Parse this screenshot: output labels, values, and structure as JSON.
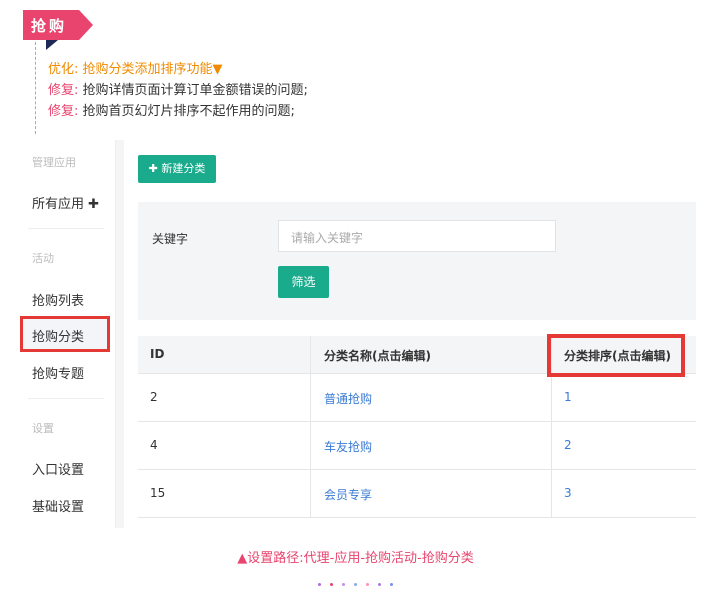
{
  "title_tag": "抢购",
  "notes": [
    {
      "kind": "优化:",
      "text": "抢购分类添加排序功能▼",
      "style": "opt"
    },
    {
      "kind": "修复:",
      "text": "抢购详情页面计算订单金额错误的问题;",
      "style": "fix"
    },
    {
      "kind": "修复:",
      "text": "抢购首页幻灯片排序不起作用的问题;",
      "style": "fix"
    }
  ],
  "sidebar": {
    "group_manage": "管理应用",
    "all_apps": "所有应用 ✚",
    "group_activity": "活动",
    "items": [
      "抢购列表",
      "抢购分类",
      "抢购专题"
    ],
    "group_settings": "设置",
    "settings_items": [
      "入口设置",
      "基础设置"
    ]
  },
  "toolbar": {
    "add_category": "✚ 新建分类"
  },
  "filter": {
    "keyword_label": "关键字",
    "keyword_placeholder": "请输入关键字",
    "filter_button": "筛选"
  },
  "table": {
    "headers": [
      "ID",
      "分类名称(点击编辑)",
      "分类排序(点击编辑)"
    ],
    "rows": [
      {
        "id": "2",
        "name": "普通抢购",
        "order": "1"
      },
      {
        "id": "4",
        "name": "车友抢购",
        "order": "2"
      },
      {
        "id": "15",
        "name": "会员专享",
        "order": "3"
      }
    ]
  },
  "caption": "▲设置路径:代理-应用-抢购活动-抢购分类",
  "colors": {
    "accent": "#e8446e",
    "orange": "#f08a00",
    "green": "#1aaa8c",
    "highlight_red": "#e53935",
    "link": "#3a7bd5"
  },
  "dot_colors": [
    "#b36ae2",
    "#e8446e",
    "#c48fe6",
    "#8ea8f0",
    "#ff8fc0",
    "#a97be8",
    "#7a8ff0"
  ]
}
